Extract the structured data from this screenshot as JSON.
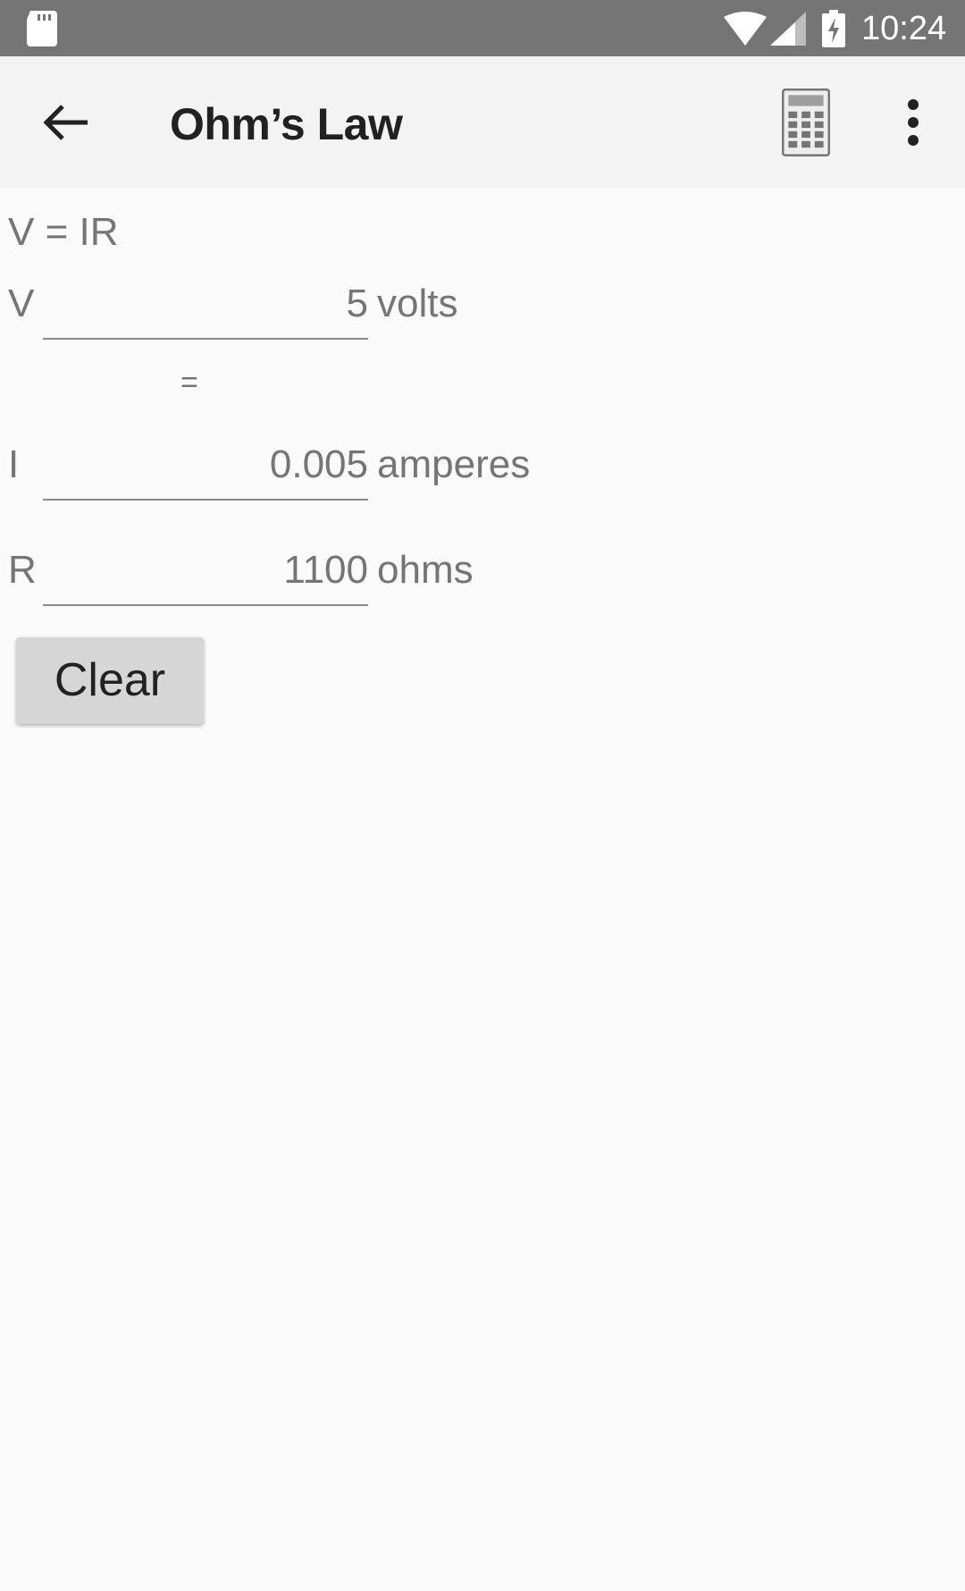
{
  "status_bar": {
    "time": "10:24",
    "icons": [
      "sd-card-icon",
      "wifi-icon",
      "signal-icon",
      "battery-charging-icon"
    ]
  },
  "app_bar": {
    "title": "Ohm’s Law",
    "icons": [
      "back-arrow-icon",
      "calculator-icon",
      "more-vert-icon"
    ]
  },
  "formula": "V = IR",
  "equals_sign": "=",
  "fields": {
    "voltage": {
      "label": "V",
      "value": "5",
      "unit": "volts"
    },
    "current": {
      "label": "I",
      "value": "0.005",
      "unit": "amperes"
    },
    "resistance": {
      "label": "R",
      "value": "1100",
      "unit": "ohms"
    }
  },
  "clear_button": {
    "label": "Clear"
  },
  "colors": {
    "status_bar": "#757575",
    "app_bar": "#f3f3f3",
    "background": "#fafafa",
    "text_secondary": "#757575",
    "button": "#d6d6d6"
  }
}
